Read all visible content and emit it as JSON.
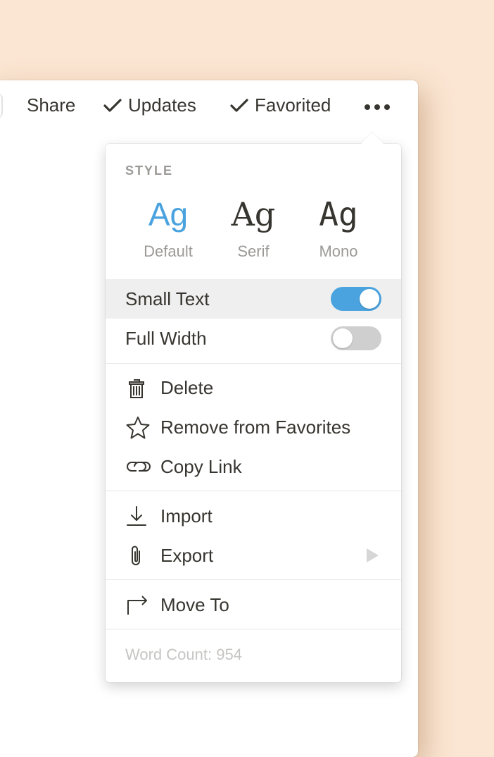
{
  "topbar": {
    "share": "Share",
    "updates": "Updates",
    "favorited": "Favorited"
  },
  "menu": {
    "style_title": "STYLE",
    "styles": [
      {
        "glyph": "Ag",
        "label": "Default",
        "selected": true
      },
      {
        "glyph": "Ag",
        "label": "Serif",
        "selected": false
      },
      {
        "glyph": "Ag",
        "label": "Mono",
        "selected": false
      }
    ],
    "toggles": [
      {
        "label": "Small Text",
        "on": true
      },
      {
        "label": "Full Width",
        "on": false
      }
    ],
    "actions": {
      "delete": "Delete",
      "remove_favorites": "Remove from Favorites",
      "copy_link": "Copy Link",
      "import": "Import",
      "export": "Export",
      "move_to": "Move To"
    },
    "word_count": "Word Count: 954"
  },
  "colors": {
    "accent": "#4aa3df",
    "background": "#fbe6d3",
    "toggle_off": "#cfcfcf",
    "highlight_row": "#efefef",
    "text": "#37352f",
    "muted": "#9b9a97"
  },
  "icons": {
    "updates": "checkmark-icon",
    "favorited": "checkmark-icon",
    "more": "more-dots-icon",
    "delete": "trash-icon",
    "remove_favorites": "star-outline-icon",
    "copy_link": "link-icon",
    "import": "download-arrow-icon",
    "export": "paperclip-icon",
    "move_to": "move-arrow-icon",
    "export_submenu": "triangle-right-icon"
  }
}
